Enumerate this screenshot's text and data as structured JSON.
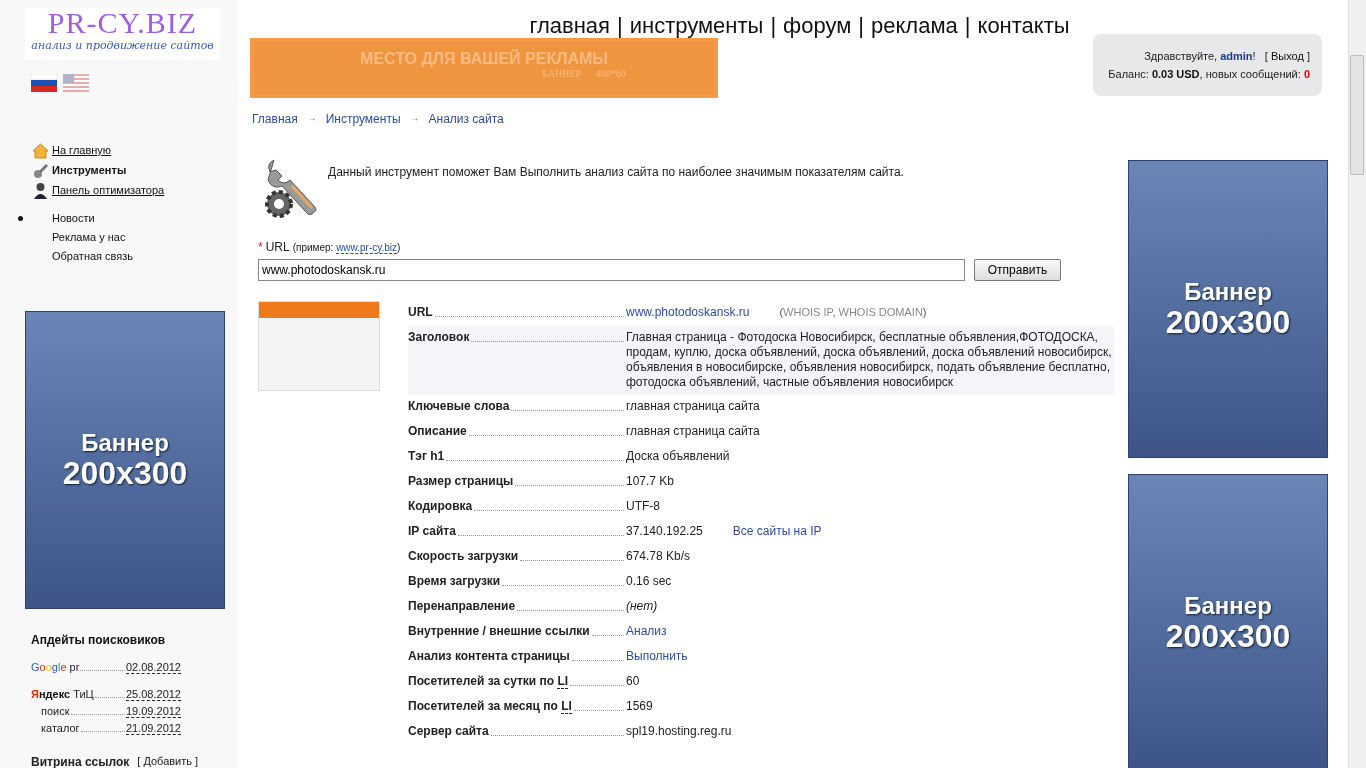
{
  "logo": {
    "title": "PR-CY.BIZ",
    "tagline": "анализ и продвижение сайтов"
  },
  "languages": [
    {
      "kind": "ru",
      "selected": true
    },
    {
      "kind": "us",
      "selected": false
    }
  ],
  "sidebar_nav": [
    {
      "kind": "home",
      "label": "На главную",
      "selected": false
    },
    {
      "kind": "tools",
      "label": "Инструменты",
      "selected": true
    },
    {
      "kind": "person",
      "label": "Панель оптимизатора",
      "selected": false
    }
  ],
  "sidebar_links": [
    {
      "label": "Новости",
      "selected": true
    },
    {
      "label": "Реклама у нас",
      "selected": false
    },
    {
      "label": "Обратная связь",
      "selected": false
    }
  ],
  "sidebar_banner": {
    "title": "Баннер",
    "size": "200x300"
  },
  "updates": {
    "title": "Апдейты поисковиков",
    "engines": [
      {
        "kind": "google",
        "brand": "Google",
        "label": "pr",
        "date": "02.08.2012"
      },
      {
        "kind": "yandex",
        "brand": "Яндекс",
        "label": "ТиЦ",
        "date": "25.08.2012",
        "children": [
          {
            "label": "поиск",
            "date": "19.09.2012"
          },
          {
            "label": "каталог",
            "date": "21.09.2012"
          }
        ]
      }
    ]
  },
  "links_showcase": {
    "title": "Витрина ссылок",
    "action": "[ Добавить ]"
  },
  "top_nav": {
    "separator": "|",
    "items": [
      "главная",
      "инструменты",
      "форум",
      "реклама",
      "контакты"
    ]
  },
  "ad_banner": {
    "title": "МЕСТО ДЛЯ ВАШЕЙ РЕКЛАМЫ",
    "subtitle": "БАННЕР",
    "size": "468*60"
  },
  "account": {
    "greeting": "Здравствуйте,",
    "user": "admin",
    "exclaim": "!",
    "logout_open": "[",
    "logout": "Выход",
    "logout_close": "]",
    "balance_label": "Баланс:",
    "balance": "0.03 USD",
    "messages_label": ", новых сообщений:",
    "messages": "0"
  },
  "breadcrumb": {
    "separator": "→",
    "items": [
      "Главная",
      "Инструменты",
      "Анализ сайта"
    ]
  },
  "intro": "Данный инструмент поможет Вам Выполнить анализ сайта по наиболее значимым показателям сайта.",
  "form": {
    "required_mark": "*",
    "label": "URL",
    "example_prefix": "(пример:",
    "example": "www.pr-cy.biz",
    "example_suffix": ")",
    "value": "www.photodoskansk.ru",
    "submit": "Отправить"
  },
  "results": [
    {
      "label": "URL",
      "kind": "link",
      "value": "www.photodoskansk.ru",
      "shaded": false,
      "whois": {
        "prefix": "(",
        "links": [
          "WHOIS IP",
          "WHOIS DOMAIN"
        ],
        "separator": ",",
        "suffix": ")"
      }
    },
    {
      "label": "Заголовок",
      "kind": "text",
      "value": "Главная страница - Фотодоска Новосибирск, бесплатные объявления,ФОТОДОСКА, продам, куплю, доска объявлений, доска объявлений, доска объявлений новосибирск, объявления в новосибирске, объявления новосибирск, подать объявление бесплатно, фотодоска объявлений, частные объявления новосибирск",
      "shaded": true
    },
    {
      "label": "Ключевые слова",
      "kind": "text",
      "value": "главная страница сайта",
      "shaded": false
    },
    {
      "label": "Описание",
      "kind": "text",
      "value": "главная страница сайта",
      "shaded": false
    },
    {
      "label": "Тэг h1",
      "kind": "text",
      "value": "Доска объявлений",
      "shaded": false
    },
    {
      "label": "Размер страницы",
      "kind": "text",
      "value": "107.7 Kb",
      "shaded": false
    },
    {
      "label": "Кодировка",
      "kind": "text",
      "value": "UTF-8",
      "shaded": false
    },
    {
      "label": "IP сайта",
      "kind": "text",
      "value": "37.140.192.25",
      "shaded": false,
      "extra_link": "Все сайты на IP"
    },
    {
      "label": "Скорость загрузки",
      "kind": "text",
      "value": "674.78 Kb/s",
      "shaded": false
    },
    {
      "label": "Время загрузки",
      "kind": "text",
      "value": "0.16 sec",
      "shaded": false
    },
    {
      "label": "Перенаправление",
      "kind": "italic",
      "value": "(нет)",
      "shaded": false
    },
    {
      "label": "Внутренние / внешние ссылки",
      "kind": "link",
      "value": "Анализ",
      "shaded": false
    },
    {
      "label": "Анализ контента страницы",
      "kind": "link",
      "value": "Выполнить",
      "shaded": false
    },
    {
      "label": "Посетителей за сутки по",
      "abbr": "LI",
      "kind": "text",
      "value": "60",
      "shaded": false
    },
    {
      "label": "Посетителей за месяц по",
      "abbr": "LI",
      "kind": "text",
      "value": "1569",
      "shaded": false
    },
    {
      "label": "Сервер сайта",
      "kind": "text",
      "value": "spl19.hosting.reg.ru",
      "shaded": false
    }
  ],
  "right_banners": [
    {
      "title": "Баннер",
      "size": "200x300"
    },
    {
      "title": "Баннер",
      "size": "200x300"
    }
  ]
}
